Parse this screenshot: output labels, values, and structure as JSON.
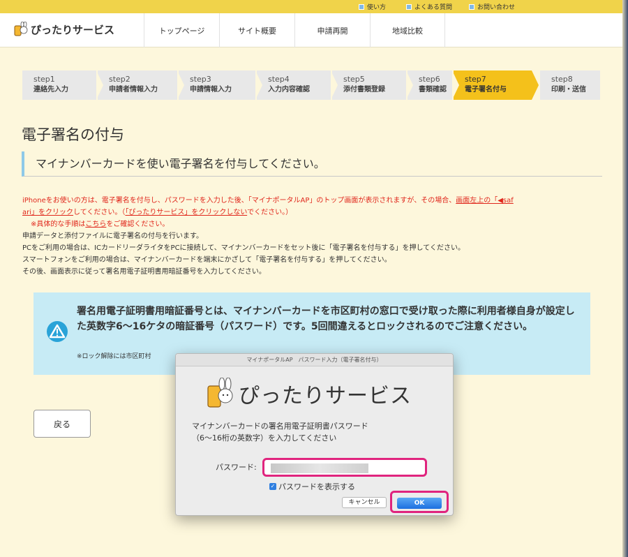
{
  "utility_links": [
    {
      "label": "使い方"
    },
    {
      "label": "よくある質問"
    },
    {
      "label": "お問い合わせ"
    }
  ],
  "header": {
    "site_name": "ぴったりサービス",
    "nav": [
      "トップページ",
      "サイト概要",
      "申請再開",
      "地域比較"
    ]
  },
  "steps": [
    {
      "num": "step1",
      "label": "連絡先入力"
    },
    {
      "num": "step2",
      "label": "申請者情報入力"
    },
    {
      "num": "step3",
      "label": "申請情報入力"
    },
    {
      "num": "step4",
      "label": "入力内容確認"
    },
    {
      "num": "step5",
      "label": "添付書類登録"
    },
    {
      "num": "step6",
      "label": "書類確認"
    },
    {
      "num": "step7",
      "label": "電子署名付与",
      "active": true
    },
    {
      "num": "step8",
      "label": "印刷・送信"
    }
  ],
  "page": {
    "title": "電子署名の付与",
    "subtitle": "マイナンバーカードを使い電子署名を付与してください。"
  },
  "notes": {
    "iphone_a": "iPhoneをお使いの方は、電子署名を付与し、パスワードを入力した後、「マイナポータルAP」のトップ画面が表示されますが、その場合、",
    "iphone_link1": "画面左上の「◀saf",
    "iphone_link1b": "ari」をクリック",
    "iphone_b": "してください。（",
    "iphone_link2": "「ぴったりサービス」をクリックしない",
    "iphone_c": "でください。）",
    "detail_a": "※具体的な手順は",
    "detail_link": "こちら",
    "detail_b": "をご確認ください。",
    "line1": "申請データと添付ファイルに電子署名の付与を行います。",
    "line2": "PCをご利用の場合は、ICカードリーダライタをPCに接続して、マイナンバーカードをセット後に「電子署名を付与する」を押してください。",
    "line3": "スマートフォンをご利用の場合は、マイナンバーカードを端末にかざして「電子署名を付与する」を押してください。",
    "line4": "その後、画面表示に従って署名用電子証明書用暗証番号を入力してください。"
  },
  "warning": {
    "text": "署名用電子証明書用暗証番号とは、マイナンバーカードを市区町村の窓口で受け取った際に利用者様自身が設定した英数字6〜16ケタの暗証番号（パスワード）です。5回間違えるとロックされるのでご注意ください。",
    "small": "※ロック解除には市区町村"
  },
  "back_button": "戻る",
  "dialog": {
    "title": "マイナポータルAP　パスワード入力（電子署名付与）",
    "logo_text": "ぴったりサービス",
    "message_line1": "マイナンバーカードの署名用電子証明書パスワード",
    "message_line2": "（6〜16桁の英数字）を入力してください",
    "password_label": "パスワード:",
    "show_password_label": "パスワードを表示する",
    "show_password_checked": true,
    "cancel_label": "キャンセル",
    "ok_label": "OK"
  },
  "colors": {
    "util_bar": "#f0d34a",
    "active_step": "#f4c11b",
    "warning_bg": "#c7ebf5",
    "highlight": "#e0247e",
    "red_text": "#e0261b"
  }
}
